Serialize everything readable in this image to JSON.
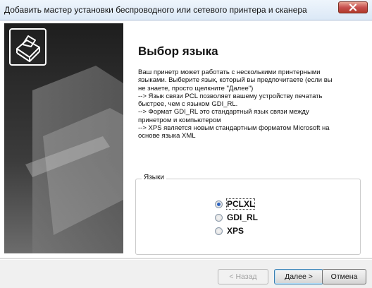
{
  "window": {
    "title": "Добавить мастер установки беспроводного или сетевого принтера и сканера"
  },
  "page": {
    "heading": "Выбор языка",
    "description_lines": [
      "Ваш принетр может работать с несколькими принтерными",
      "языками. Выберите  язык, который вы предпочитаете (если вы",
      "не знаете, просто щелкните \"Далее\")",
      "--> Язык связи PCL позволяет вашему устройству печатать",
      "быстрее, чем с языком GDI_RL.",
      "--> Формат GDI_RL это стандартный язык связи между",
      "принетром и компьютером",
      "--> XPS является новым стандартным форматом Microsoft на",
      "основе языка XML"
    ]
  },
  "languages": {
    "group_label": "Языки",
    "options": [
      {
        "label": "PCLXL",
        "selected": true
      },
      {
        "label": "GDI_RL",
        "selected": false
      },
      {
        "label": "XPS",
        "selected": false
      }
    ]
  },
  "buttons": {
    "back": "< Назад",
    "next": "Далее >",
    "cancel": "Отмена"
  },
  "colors": {
    "close_button": "#c75050",
    "radio_selected": "#2d64c0",
    "default_button_border": "#3c7fb1"
  }
}
